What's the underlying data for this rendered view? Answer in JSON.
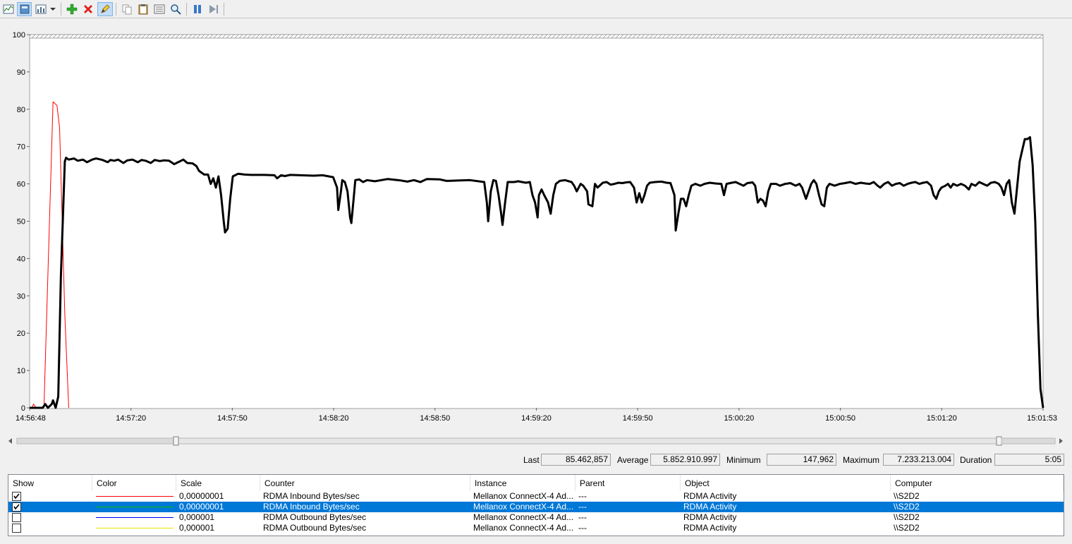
{
  "toolbar": {
    "buttons": [
      "view-current-activity",
      "view-log-data",
      "change-graph-type",
      "add-counter",
      "delete-counter",
      "highlight",
      "copy-properties",
      "paste-counter-list",
      "properties",
      "zoom",
      "freeze-display",
      "update-data"
    ]
  },
  "chart": {
    "y_ticks": [
      "0",
      "10",
      "20",
      "30",
      "40",
      "50",
      "60",
      "70",
      "80",
      "90",
      "100"
    ],
    "x_ticks": [
      "14:56:48",
      "14:57:20",
      "14:57:50",
      "14:58:20",
      "14:58:50",
      "14:59:20",
      "14:59:50",
      "15:00:20",
      "15:00:50",
      "15:01:20",
      "15:01:53"
    ]
  },
  "stats": {
    "last_label": "Last",
    "last_value": "85.462,857",
    "average_label": "Average",
    "average_value": "5.852.910.997",
    "minimum_label": "Minimum",
    "minimum_value": "147,962",
    "maximum_label": "Maximum",
    "maximum_value": "7.233.213.004",
    "duration_label": "Duration",
    "duration_value": "5:05"
  },
  "grid": {
    "columns": [
      "Show",
      "Color",
      "Scale",
      "Counter",
      "Instance",
      "Parent",
      "Object",
      "Computer"
    ],
    "rows": [
      {
        "show": true,
        "color": "#ff0000",
        "scale": "0,00000001",
        "counter": "RDMA Inbound Bytes/sec",
        "instance": "Mellanox ConnectX-4 Ad...",
        "parent": "---",
        "object": "RDMA Activity",
        "computer": "\\\\S2D2",
        "selected": false
      },
      {
        "show": true,
        "color": "#00c000",
        "scale": "0,00000001",
        "counter": "RDMA Inbound Bytes/sec",
        "instance": "Mellanox ConnectX-4 Ad...",
        "parent": "---",
        "object": "RDMA Activity",
        "computer": "\\\\S2D2",
        "selected": true
      },
      {
        "show": false,
        "color": "#0000ff",
        "scale": "0,000001",
        "counter": "RDMA Outbound Bytes/sec",
        "instance": "Mellanox ConnectX-4 Ad...",
        "parent": "---",
        "object": "RDMA Activity",
        "computer": "\\\\S2D2",
        "selected": false
      },
      {
        "show": false,
        "color": "#e8e800",
        "scale": "0,000001",
        "counter": "RDMA Outbound Bytes/sec",
        "instance": "Mellanox ConnectX-4 Ad...",
        "parent": "---",
        "object": "RDMA Activity",
        "computer": "\\\\S2D2",
        "selected": false
      }
    ]
  },
  "chart_data": {
    "type": "line",
    "ylim": [
      0,
      100
    ],
    "xlim": [
      "14:56:48",
      "15:01:53"
    ],
    "grid": false,
    "series": [
      {
        "color": "#ff0000",
        "points": [
          [
            0,
            0
          ],
          [
            2,
            0
          ],
          [
            3,
            1
          ],
          [
            5,
            0
          ],
          [
            7,
            0
          ],
          [
            11,
            0
          ],
          [
            18,
            82
          ],
          [
            21,
            81
          ],
          [
            23,
            75
          ],
          [
            27,
            25
          ],
          [
            30,
            0
          ]
        ]
      },
      {
        "color": "#000000",
        "points": [
          [
            0,
            0
          ],
          [
            10,
            0
          ],
          [
            12,
            1
          ],
          [
            14,
            0
          ],
          [
            17,
            1
          ],
          [
            18,
            2
          ],
          [
            20,
            0
          ],
          [
            22,
            3
          ],
          [
            24,
            35
          ],
          [
            27,
            66
          ],
          [
            28,
            67
          ],
          [
            30,
            66.5
          ],
          [
            34,
            66.8
          ],
          [
            37,
            66.2
          ],
          [
            41,
            66.5
          ],
          [
            44,
            65.8
          ],
          [
            48,
            66.5
          ],
          [
            51,
            66.8
          ],
          [
            56,
            66.4
          ],
          [
            60,
            65.8
          ],
          [
            62,
            66.4
          ],
          [
            65,
            66.2
          ],
          [
            68,
            66.5
          ],
          [
            72,
            65.6
          ],
          [
            75,
            66.3
          ],
          [
            79,
            66.5
          ],
          [
            83,
            65.8
          ],
          [
            86,
            66.4
          ],
          [
            89,
            66.2
          ],
          [
            93,
            65.6
          ],
          [
            96,
            66.4
          ],
          [
            100,
            66.1
          ],
          [
            103,
            66.3
          ],
          [
            107,
            66.2
          ],
          [
            111,
            65.3
          ],
          [
            114,
            65.8
          ],
          [
            118,
            66.5
          ],
          [
            121,
            65.6
          ],
          [
            125,
            65.5
          ],
          [
            128,
            64.8
          ],
          [
            130,
            63.5
          ],
          [
            134,
            62.5
          ],
          [
            137,
            62.5
          ],
          [
            139,
            60
          ],
          [
            141,
            61.5
          ],
          [
            143,
            59
          ],
          [
            145,
            62
          ],
          [
            147,
            57
          ],
          [
            149,
            50
          ],
          [
            150,
            47
          ],
          [
            152,
            48
          ],
          [
            154,
            56
          ],
          [
            156,
            62
          ],
          [
            160,
            62.7
          ],
          [
            165,
            62.5
          ],
          [
            170,
            62.4
          ],
          [
            180,
            62.4
          ],
          [
            188,
            62.3
          ],
          [
            190,
            61.5
          ],
          [
            193,
            62.3
          ],
          [
            196,
            62.1
          ],
          [
            200,
            62.4
          ],
          [
            208,
            62.3
          ],
          [
            218,
            62.2
          ],
          [
            225,
            62.3
          ],
          [
            233,
            61.8
          ],
          [
            236,
            59
          ],
          [
            237,
            53
          ],
          [
            239,
            58
          ],
          [
            240,
            61
          ],
          [
            242,
            60.5
          ],
          [
            244,
            58
          ],
          [
            246,
            51
          ],
          [
            247,
            49.5
          ],
          [
            249,
            57
          ],
          [
            250,
            61
          ],
          [
            253,
            61.2
          ],
          [
            256,
            60.5
          ],
          [
            259,
            61
          ],
          [
            265,
            60.7
          ],
          [
            275,
            61.3
          ],
          [
            285,
            60.9
          ],
          [
            290,
            60.6
          ],
          [
            295,
            61
          ],
          [
            300,
            60.5
          ],
          [
            305,
            61.3
          ],
          [
            315,
            61.2
          ],
          [
            320,
            60.8
          ],
          [
            330,
            60.9
          ],
          [
            338,
            61
          ],
          [
            349,
            60.5
          ],
          [
            351,
            55
          ],
          [
            352,
            50
          ],
          [
            354,
            58
          ],
          [
            356,
            61
          ],
          [
            358,
            60.8
          ],
          [
            360,
            57
          ],
          [
            362,
            52
          ],
          [
            363,
            49
          ],
          [
            365,
            55
          ],
          [
            367,
            60.5
          ],
          [
            372,
            60.5
          ],
          [
            375,
            60.7
          ],
          [
            378,
            60.5
          ],
          [
            381,
            60.3
          ],
          [
            384,
            60.5
          ],
          [
            386,
            57
          ],
          [
            388,
            55
          ],
          [
            390,
            51
          ],
          [
            391,
            57
          ],
          [
            393,
            58.5
          ],
          [
            395,
            57
          ],
          [
            398,
            55
          ],
          [
            400,
            52
          ],
          [
            402,
            57
          ],
          [
            404,
            60
          ],
          [
            407,
            60.8
          ],
          [
            411,
            61
          ],
          [
            416,
            60.5
          ],
          [
            418,
            59.5
          ],
          [
            420,
            58
          ],
          [
            423,
            60
          ],
          [
            425,
            59.5
          ],
          [
            428,
            58
          ],
          [
            429,
            54.5
          ],
          [
            432,
            54
          ],
          [
            434,
            60
          ],
          [
            436,
            59
          ],
          [
            440,
            60.3
          ],
          [
            443,
            60.5
          ],
          [
            446,
            59.8
          ],
          [
            449,
            60
          ],
          [
            452,
            60.3
          ],
          [
            455,
            60.2
          ],
          [
            458,
            60.4
          ],
          [
            461,
            60.5
          ],
          [
            464,
            59
          ],
          [
            466,
            55
          ],
          [
            468,
            57.5
          ],
          [
            470,
            55
          ],
          [
            472,
            57
          ],
          [
            474,
            59.5
          ],
          [
            476,
            60.3
          ],
          [
            480,
            60.5
          ],
          [
            485,
            60.6
          ],
          [
            489,
            60.3
          ],
          [
            492,
            60.2
          ],
          [
            495,
            57
          ],
          [
            496,
            47.5
          ],
          [
            498,
            52
          ],
          [
            500,
            56
          ],
          [
            502,
            56
          ],
          [
            504,
            54
          ],
          [
            506,
            57
          ],
          [
            508,
            59.5
          ],
          [
            511,
            60
          ],
          [
            515,
            59.5
          ],
          [
            518,
            60
          ],
          [
            522,
            60.3
          ],
          [
            527,
            60.1
          ],
          [
            531,
            60
          ],
          [
            533,
            57
          ],
          [
            535,
            60
          ],
          [
            539,
            60.3
          ],
          [
            542,
            60.5
          ],
          [
            545,
            60
          ],
          [
            548,
            59.5
          ],
          [
            551,
            60.2
          ],
          [
            555,
            60.4
          ],
          [
            557,
            59.5
          ],
          [
            559,
            55
          ],
          [
            561,
            56
          ],
          [
            563,
            55.5
          ],
          [
            565,
            54
          ],
          [
            567,
            58
          ],
          [
            569,
            60
          ],
          [
            573,
            60
          ],
          [
            576,
            59.5
          ],
          [
            580,
            60
          ],
          [
            584,
            60.2
          ],
          [
            588,
            59.5
          ],
          [
            591,
            60
          ],
          [
            593,
            59
          ],
          [
            596,
            56
          ],
          [
            598,
            58
          ],
          [
            600,
            60
          ],
          [
            602,
            61
          ],
          [
            604,
            60
          ],
          [
            606,
            57
          ],
          [
            608,
            54.5
          ],
          [
            610,
            54
          ],
          [
            612,
            59
          ],
          [
            614,
            60
          ],
          [
            618,
            59.5
          ],
          [
            622,
            60
          ],
          [
            626,
            60.2
          ],
          [
            630,
            60.5
          ],
          [
            634,
            60
          ],
          [
            638,
            60.3
          ],
          [
            642,
            60.1
          ],
          [
            645,
            60
          ],
          [
            648,
            60.5
          ],
          [
            651,
            59.5
          ],
          [
            653,
            59
          ],
          [
            656,
            60
          ],
          [
            659,
            60.5
          ],
          [
            662,
            59.5
          ],
          [
            665,
            60
          ],
          [
            668,
            60.2
          ],
          [
            671,
            59.5
          ],
          [
            674,
            60
          ],
          [
            677,
            60.3
          ],
          [
            680,
            60.5
          ],
          [
            683,
            60
          ],
          [
            686,
            60.3
          ],
          [
            689,
            60.5
          ],
          [
            692,
            59.5
          ],
          [
            694,
            57
          ],
          [
            696,
            56
          ],
          [
            698,
            58
          ],
          [
            700,
            59
          ],
          [
            703,
            59.5
          ],
          [
            705,
            60
          ],
          [
            707,
            59
          ],
          [
            709,
            60
          ],
          [
            712,
            59.5
          ],
          [
            715,
            60
          ],
          [
            718,
            59.5
          ],
          [
            721,
            58.5
          ],
          [
            723,
            60
          ],
          [
            726,
            59.5
          ],
          [
            729,
            60.5
          ],
          [
            732,
            60
          ],
          [
            735,
            59.5
          ],
          [
            738,
            60.3
          ],
          [
            741,
            60.5
          ],
          [
            744,
            60
          ],
          [
            746,
            59
          ],
          [
            748,
            57
          ],
          [
            750,
            60
          ],
          [
            752,
            61
          ],
          [
            754,
            55
          ],
          [
            756,
            52
          ],
          [
            758,
            59
          ],
          [
            760,
            66
          ],
          [
            762,
            69
          ],
          [
            764,
            72
          ],
          [
            766,
            72
          ],
          [
            768,
            72.5
          ],
          [
            770,
            65
          ],
          [
            772,
            50
          ],
          [
            774,
            25
          ],
          [
            776,
            5
          ],
          [
            778,
            0
          ]
        ]
      }
    ]
  }
}
